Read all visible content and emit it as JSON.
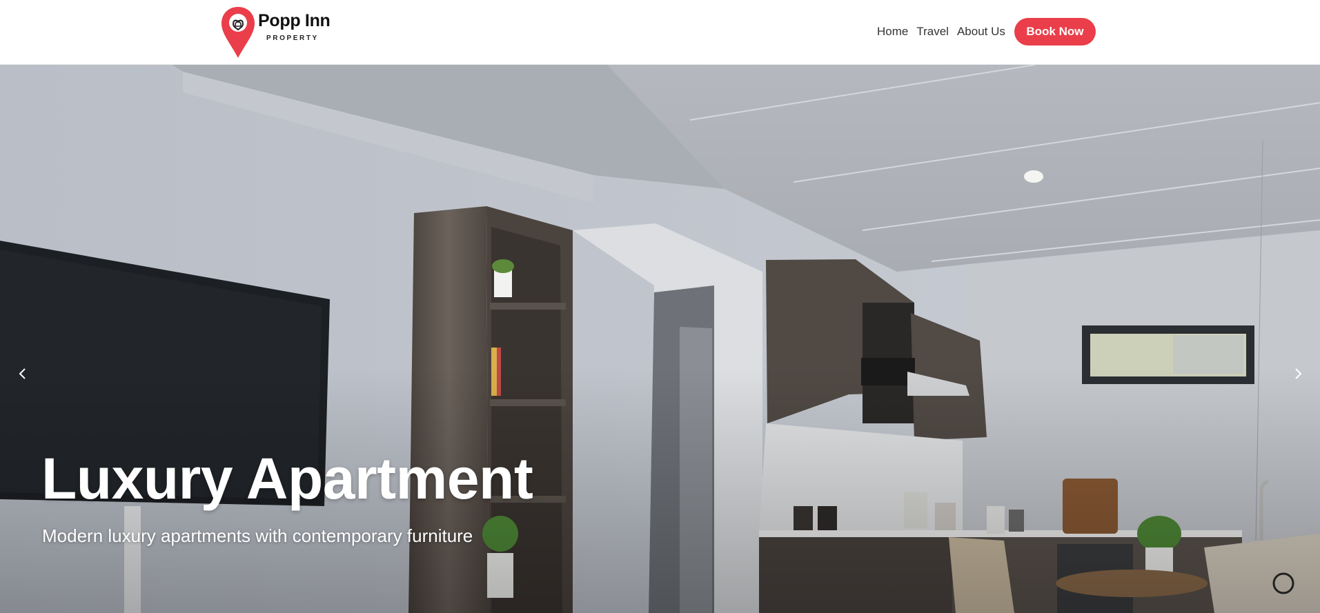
{
  "header": {
    "brand_name": "Popp Inn",
    "brand_sub": "PROPERTY",
    "accent_color": "#ea3e4a"
  },
  "nav": {
    "items": [
      {
        "label": "Home"
      },
      {
        "label": "Travel"
      },
      {
        "label": "About Us"
      }
    ],
    "cta_label": "Book Now"
  },
  "hero": {
    "title": "Luxury Apartment",
    "subtitle": "Modern luxury apartments with contemporary furniture",
    "prev_icon": "chevron-left-icon",
    "next_icon": "chevron-right-icon"
  }
}
